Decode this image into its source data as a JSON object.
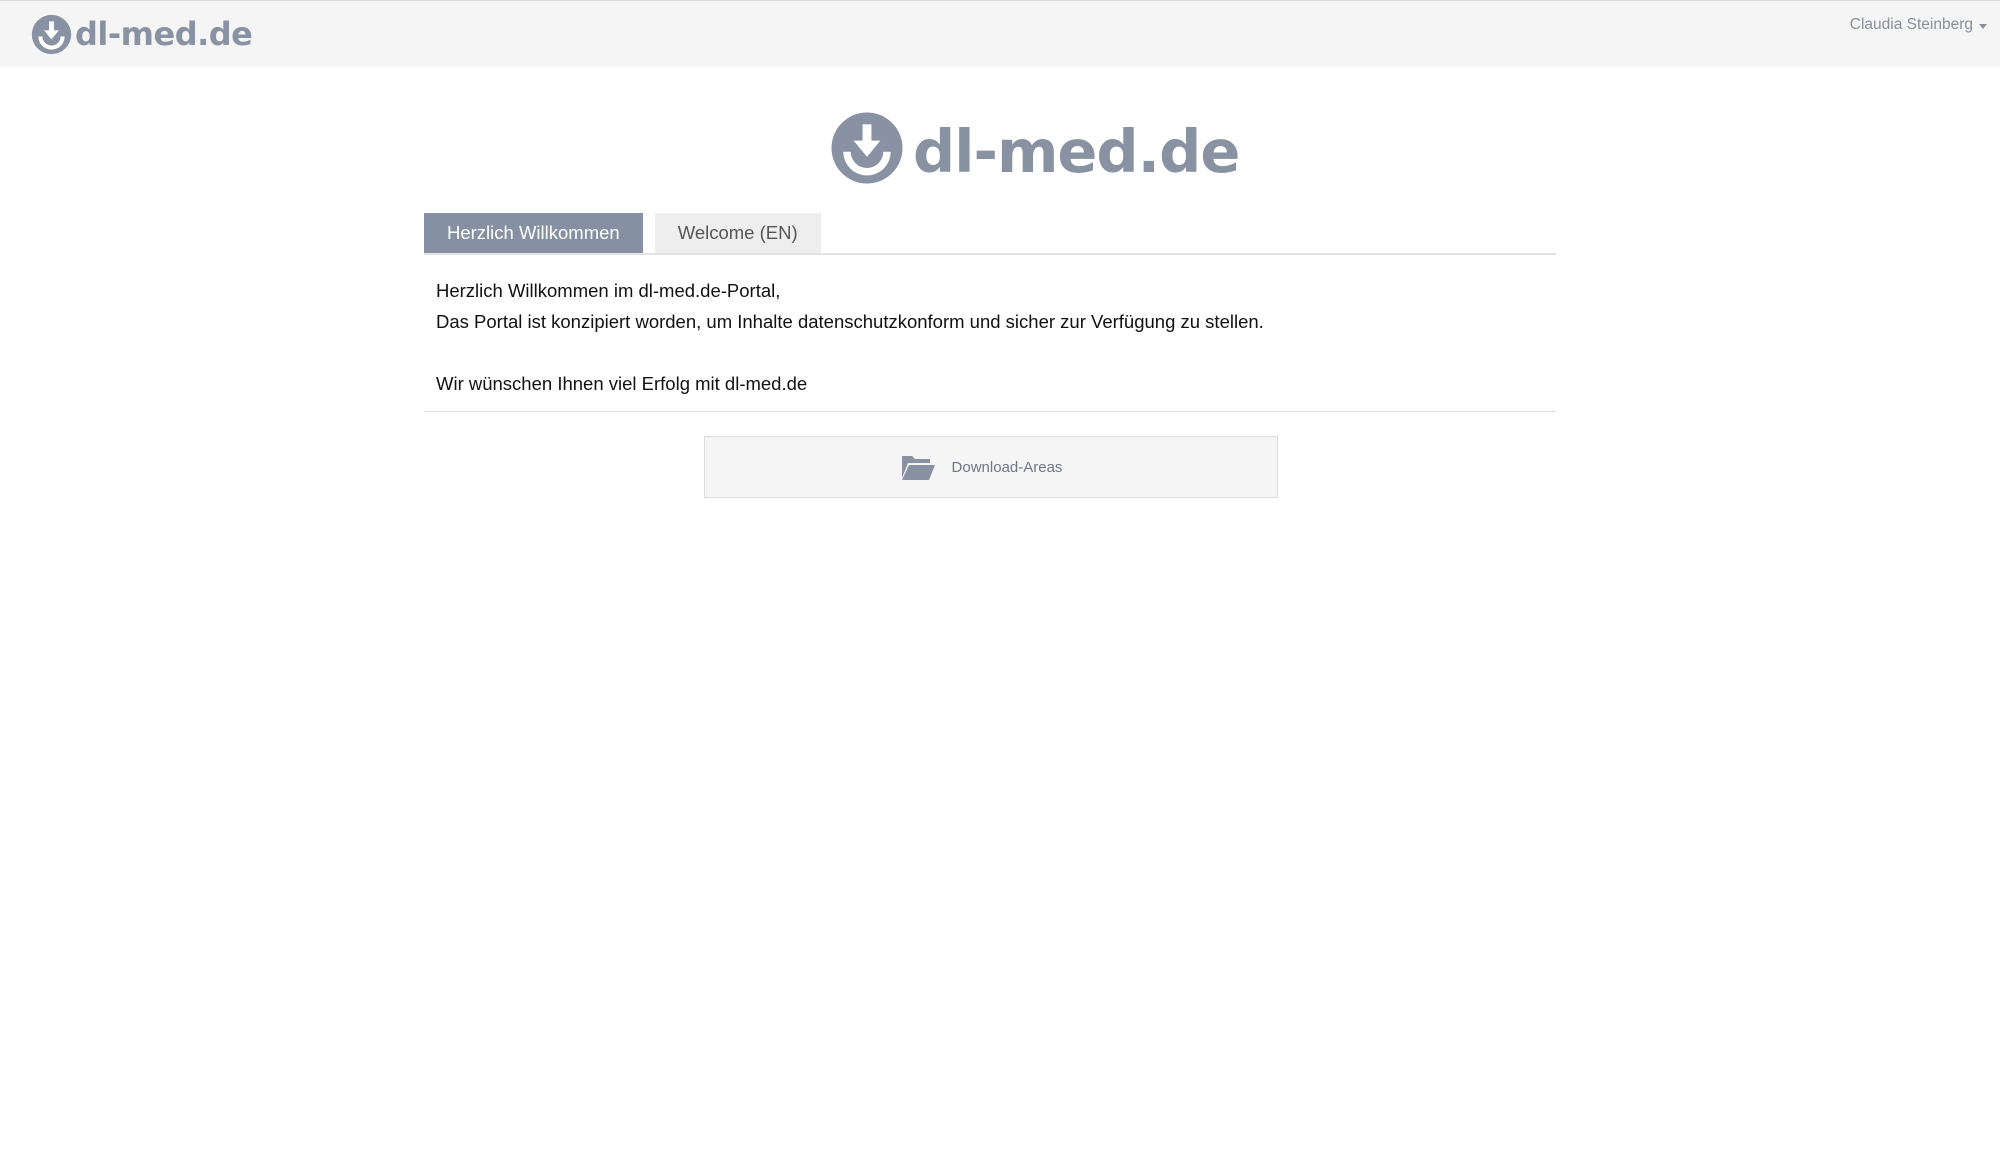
{
  "navbar": {
    "brand_text": "dl-med.de",
    "brand_icon": "download-circle-icon",
    "user_name": "Claudia Steinberg"
  },
  "logo": {
    "text": "dl-med.de",
    "icon": "download-circle-icon"
  },
  "tabs": [
    {
      "label": "Herzlich Willkommen",
      "active": true
    },
    {
      "label": "Welcome (EN)",
      "active": false
    }
  ],
  "tab_content": {
    "line1": "Herzlich Willkommen im dl-med.de-Portal,",
    "line2": "Das Portal ist konzipiert worden, um Inhalte datenschutzkonform und sicher zur Verfügung zu stellen.",
    "line3": "Wir wünschen Ihnen viel Erfolg mit dl-med.de"
  },
  "download_button": {
    "label": "Download-Areas",
    "icon": "folder-open-icon"
  },
  "colors": {
    "brand": "#8892a2",
    "tab_active_bg": "#8590a2",
    "navbar_bg": "#f5f5f5"
  }
}
